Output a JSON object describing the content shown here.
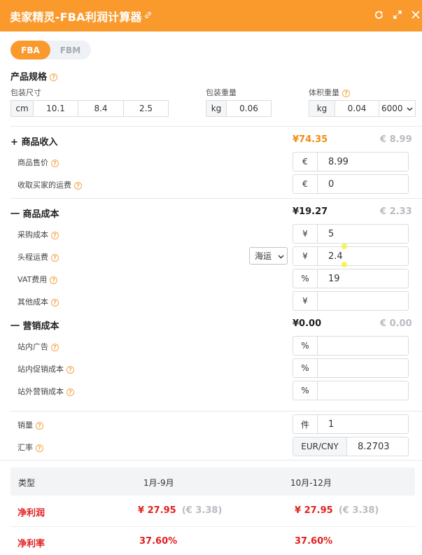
{
  "title": "卖家精灵-FBA利润计算器",
  "tabs": [
    "FBA",
    "FBM"
  ],
  "spec": {
    "title": "产品规格",
    "size_label": "包装尺寸",
    "weight_label": "包装重量",
    "volume_label": "体积重量",
    "size_unit": "cm",
    "dims": [
      "10.1",
      "8.4",
      "2.5"
    ],
    "weight_unit": "kg",
    "weight_value": "0.06",
    "volume_unit": "kg",
    "volume_value": "0.04",
    "divisor": "6000"
  },
  "income": {
    "title": "商品收入",
    "toggle": "+",
    "cny": "¥74.35",
    "eur": "€ 8.99",
    "rows": [
      {
        "label": "商品售价",
        "prefix": "€",
        "value": "8.99"
      },
      {
        "label": "收取买家的运费",
        "prefix": "€",
        "value": "0"
      }
    ]
  },
  "cost": {
    "title": "商品成本",
    "toggle": "一",
    "cny": "¥19.27",
    "eur": "€ 2.33",
    "shipping_method": "海运",
    "rows": [
      {
        "label": "采购成本",
        "prefix": "¥",
        "value": "5"
      },
      {
        "label": "头程运费",
        "prefix": "¥",
        "value": "2.4"
      },
      {
        "label": "VAT费用",
        "prefix": "%",
        "value": "19"
      },
      {
        "label": "其他成本",
        "prefix": "¥",
        "value": ""
      }
    ]
  },
  "marketing": {
    "title": "营销成本",
    "toggle": "一",
    "cny": "¥0.00",
    "eur": "€ 0.00",
    "rows": [
      {
        "label": "站内广告",
        "prefix": "%",
        "value": ""
      },
      {
        "label": "站内促销成本",
        "prefix": "%",
        "value": ""
      },
      {
        "label": "站外营销成本",
        "prefix": "%",
        "value": ""
      }
    ]
  },
  "misc": {
    "rows": [
      {
        "label": "销量",
        "prefix": "件",
        "value": "1"
      },
      {
        "label": "汇率",
        "prefix": "EUR/CNY",
        "value": "8.2703"
      }
    ]
  },
  "summary": {
    "headers": [
      "类型",
      "1月-9月",
      "10月-12月"
    ],
    "profit_label": "净利润",
    "profit_a_cny": "¥ 27.95",
    "profit_a_eur": "(€ 3.38)",
    "profit_b_cny": "¥ 27.95",
    "profit_b_eur": "(€ 3.38)",
    "rate_label": "净利率",
    "rate_a": "37.60%",
    "rate_b": "37.60%"
  },
  "colors": {
    "accent": "#fb9a2c",
    "negative_red": "#e0201f",
    "value_orange": "#f28c16"
  }
}
